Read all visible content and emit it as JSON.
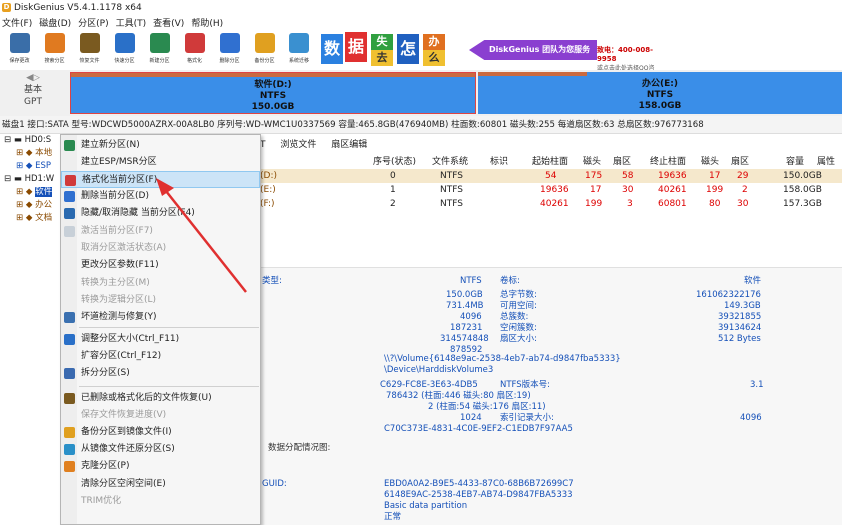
{
  "window": {
    "title": "DiskGenius V5.4.1.1178 x64"
  },
  "menu": [
    "文件(F)",
    "磁盘(D)",
    "分区(P)",
    "工具(T)",
    "查看(V)",
    "帮助(H)"
  ],
  "toolbar": [
    {
      "label": "保存更改",
      "icon": "save-icon",
      "color": "#3a6ea8"
    },
    {
      "label": "搜索分区",
      "icon": "search-icon",
      "color": "#e07a20"
    },
    {
      "label": "恢复文件",
      "icon": "recover-icon",
      "color": "#7a5a20"
    },
    {
      "label": "快速分区",
      "icon": "quick-partition-icon",
      "color": "#2a70c8"
    },
    {
      "label": "新建分区",
      "icon": "new-partition-icon",
      "color": "#2a8a50"
    },
    {
      "label": "格式化",
      "icon": "format-icon",
      "color": "#d03a3a"
    },
    {
      "label": "删除分区",
      "icon": "delete-icon",
      "color": "#3070d0"
    },
    {
      "label": "备份分区",
      "icon": "backup-icon",
      "color": "#e0a020"
    },
    {
      "label": "系统迁移",
      "icon": "migrate-icon",
      "color": "#3a90d0"
    }
  ],
  "banner": {
    "chars": [
      "数",
      "据",
      "失",
      "怎",
      "办"
    ],
    "char_colors": [
      "#2a80e0",
      "#e03030",
      "#30a040",
      "#2060c0",
      "#e07020"
    ],
    "extra_chars": [
      "去",
      "么"
    ],
    "service": "DiskGenius 团队为您服务",
    "phone": "致电：400-008-9958",
    "qq": "或点击此处选择QQ咨询"
  },
  "diskmap": {
    "nav_label_1": "基本",
    "nav_label_2": "GPT",
    "partitions": [
      {
        "name": "软件(D:)",
        "fs": "NTFS",
        "size": "150.0GB"
      },
      {
        "name": "办公(E:)",
        "fs": "NTFS",
        "size": "158.0GB"
      }
    ]
  },
  "infobar": "磁盘1 接口:SATA  型号:WDCWD5000AZRX-00A8LB0  序列号:WD-WMC1U0337569  容量:465.8GB(476940MB)  柱面数:60801  磁头数:255  每道扇区数:63  总扇区数:976773168",
  "tree": [
    "HD0:S",
    "本地",
    "ESP",
    "HD1:W",
    "软件",
    "办公",
    "文档"
  ],
  "tabs": [
    "T",
    "浏览文件",
    "扇区编辑"
  ],
  "table": {
    "headers": [
      "序号(状态)",
      "文件系统",
      "标识",
      "起始柱面",
      "磁头",
      "扇区",
      "终止柱面",
      "磁头",
      "扇区",
      "容量",
      "属性"
    ],
    "rows": [
      {
        "name": "(D:)",
        "idx": "0",
        "fs": "NTFS",
        "sc": "54",
        "sh": "175",
        "ss": "58",
        "ec": "19636",
        "eh": "17",
        "es": "29",
        "cap": "150.0GB"
      },
      {
        "name": "(E:)",
        "idx": "1",
        "fs": "NTFS",
        "sc": "19636",
        "sh": "17",
        "ss": "30",
        "ec": "40261",
        "eh": "199",
        "es": "2",
        "cap": "158.0GB"
      },
      {
        "name": "(F:)",
        "idx": "2",
        "fs": "NTFS",
        "sc": "40261",
        "sh": "199",
        "ss": "3",
        "ec": "60801",
        "eh": "80",
        "es": "30",
        "cap": "157.3GB"
      }
    ]
  },
  "details": {
    "fs_type_label": "类型:",
    "fs_type": "NTFS",
    "vol_label_label": "卷标:",
    "vol_label": "软件",
    "left_values": [
      "150.0GB",
      "731.4MB",
      "4096",
      "187231",
      "314574848",
      "878592"
    ],
    "mid_labels": [
      "总字节数:",
      "可用空间:",
      "总簇数:",
      "空闲簇数:",
      "扇区大小:"
    ],
    "right_values": [
      "161062322176",
      "149.3GB",
      "39321855",
      "39134624",
      "512 Bytes"
    ],
    "path1": "\\\\?\\Volume{6148e9ac-2538-4eb7-ab74-d9847fba5333}",
    "path2": "\\Device\\HarddiskVolume3",
    "serial": "C629-FC8E-3E63-4DB5",
    "ntfs_ver_label": "NTFS版本号:",
    "ntfs_ver": "3.1",
    "mft1": "786432 (柱面:446 磁头:80 扇区:19)",
    "mft2": "2 (柱面:54 磁头:176 扇区:11)",
    "index_size": "1024",
    "index_label": "索引记录大小:",
    "index_value": "4096",
    "guid1": "C70C373E-4831-4C0E-9EF2-C1EDB7F97AA5",
    "alloc_label": "数据分配情况图:",
    "guid_label": "GUID:",
    "type_guid": "EBD0A0A2-B9E5-4433-87C0-68B6B72699C7",
    "part_guid": "6148E9AC-2538-4EB7-AB74-D9847FBA5333",
    "part_name": "Basic data partition",
    "status": "正常"
  },
  "context_menu": [
    {
      "label": "建立新分区(N)",
      "enabled": true,
      "icon": "new-partition-icon",
      "color": "#2a8a50"
    },
    {
      "label": "建立ESP/MSR分区",
      "enabled": true,
      "icon": "",
      "color": ""
    },
    {
      "label": "格式化当前分区(F)",
      "enabled": true,
      "icon": "format-icon",
      "color": "#d03a3a",
      "highlighted": true
    },
    {
      "label": "删除当前分区(D)",
      "enabled": true,
      "icon": "delete-icon",
      "color": "#3070d0"
    },
    {
      "label": "隐藏/取消隐藏 当前分区(F4)",
      "enabled": true,
      "icon": "hide-icon",
      "color": "#2a6ab0"
    },
    {
      "label": "激活当前分区(F7)",
      "enabled": false,
      "icon": "activate-icon",
      "color": "#9ab"
    },
    {
      "label": "取消分区激活状态(A)",
      "enabled": false,
      "icon": "",
      "color": ""
    },
    {
      "label": "更改分区参数(F11)",
      "enabled": true,
      "icon": "",
      "color": ""
    },
    {
      "label": "转换为主分区(M)",
      "enabled": false,
      "icon": "",
      "color": ""
    },
    {
      "label": "转换为逻辑分区(L)",
      "enabled": false,
      "icon": "",
      "color": ""
    },
    {
      "label": "坏道检测与修复(Y)",
      "enabled": true,
      "icon": "repair-icon",
      "color": "#3a70b0"
    },
    {
      "label": "调整分区大小(Ctrl_F11)",
      "enabled": true,
      "icon": "resize-icon",
      "color": "#2a70c8"
    },
    {
      "label": "扩容分区(Ctrl_F12)",
      "enabled": true,
      "icon": "",
      "color": ""
    },
    {
      "label": "拆分分区(S)",
      "enabled": true,
      "icon": "split-icon",
      "color": "#3a6ab0"
    },
    {
      "label": "已删除或格式化后的文件恢复(U)",
      "enabled": true,
      "icon": "recover-icon",
      "color": "#7a5a20"
    },
    {
      "label": "保存文件恢复进度(V)",
      "enabled": false,
      "icon": "",
      "color": ""
    },
    {
      "label": "备份分区到镜像文件(I)",
      "enabled": true,
      "icon": "backup-icon",
      "color": "#e0a020"
    },
    {
      "label": "从镜像文件还原分区(S)",
      "enabled": true,
      "icon": "restore-icon",
      "color": "#2a90c8"
    },
    {
      "label": "克隆分区(P)",
      "enabled": true,
      "icon": "clone-icon",
      "color": "#e08020"
    },
    {
      "label": "清除分区空闲空间(E)",
      "enabled": true,
      "icon": "",
      "color": ""
    },
    {
      "label": "TRIM优化",
      "enabled": false,
      "icon": "",
      "color": ""
    }
  ]
}
